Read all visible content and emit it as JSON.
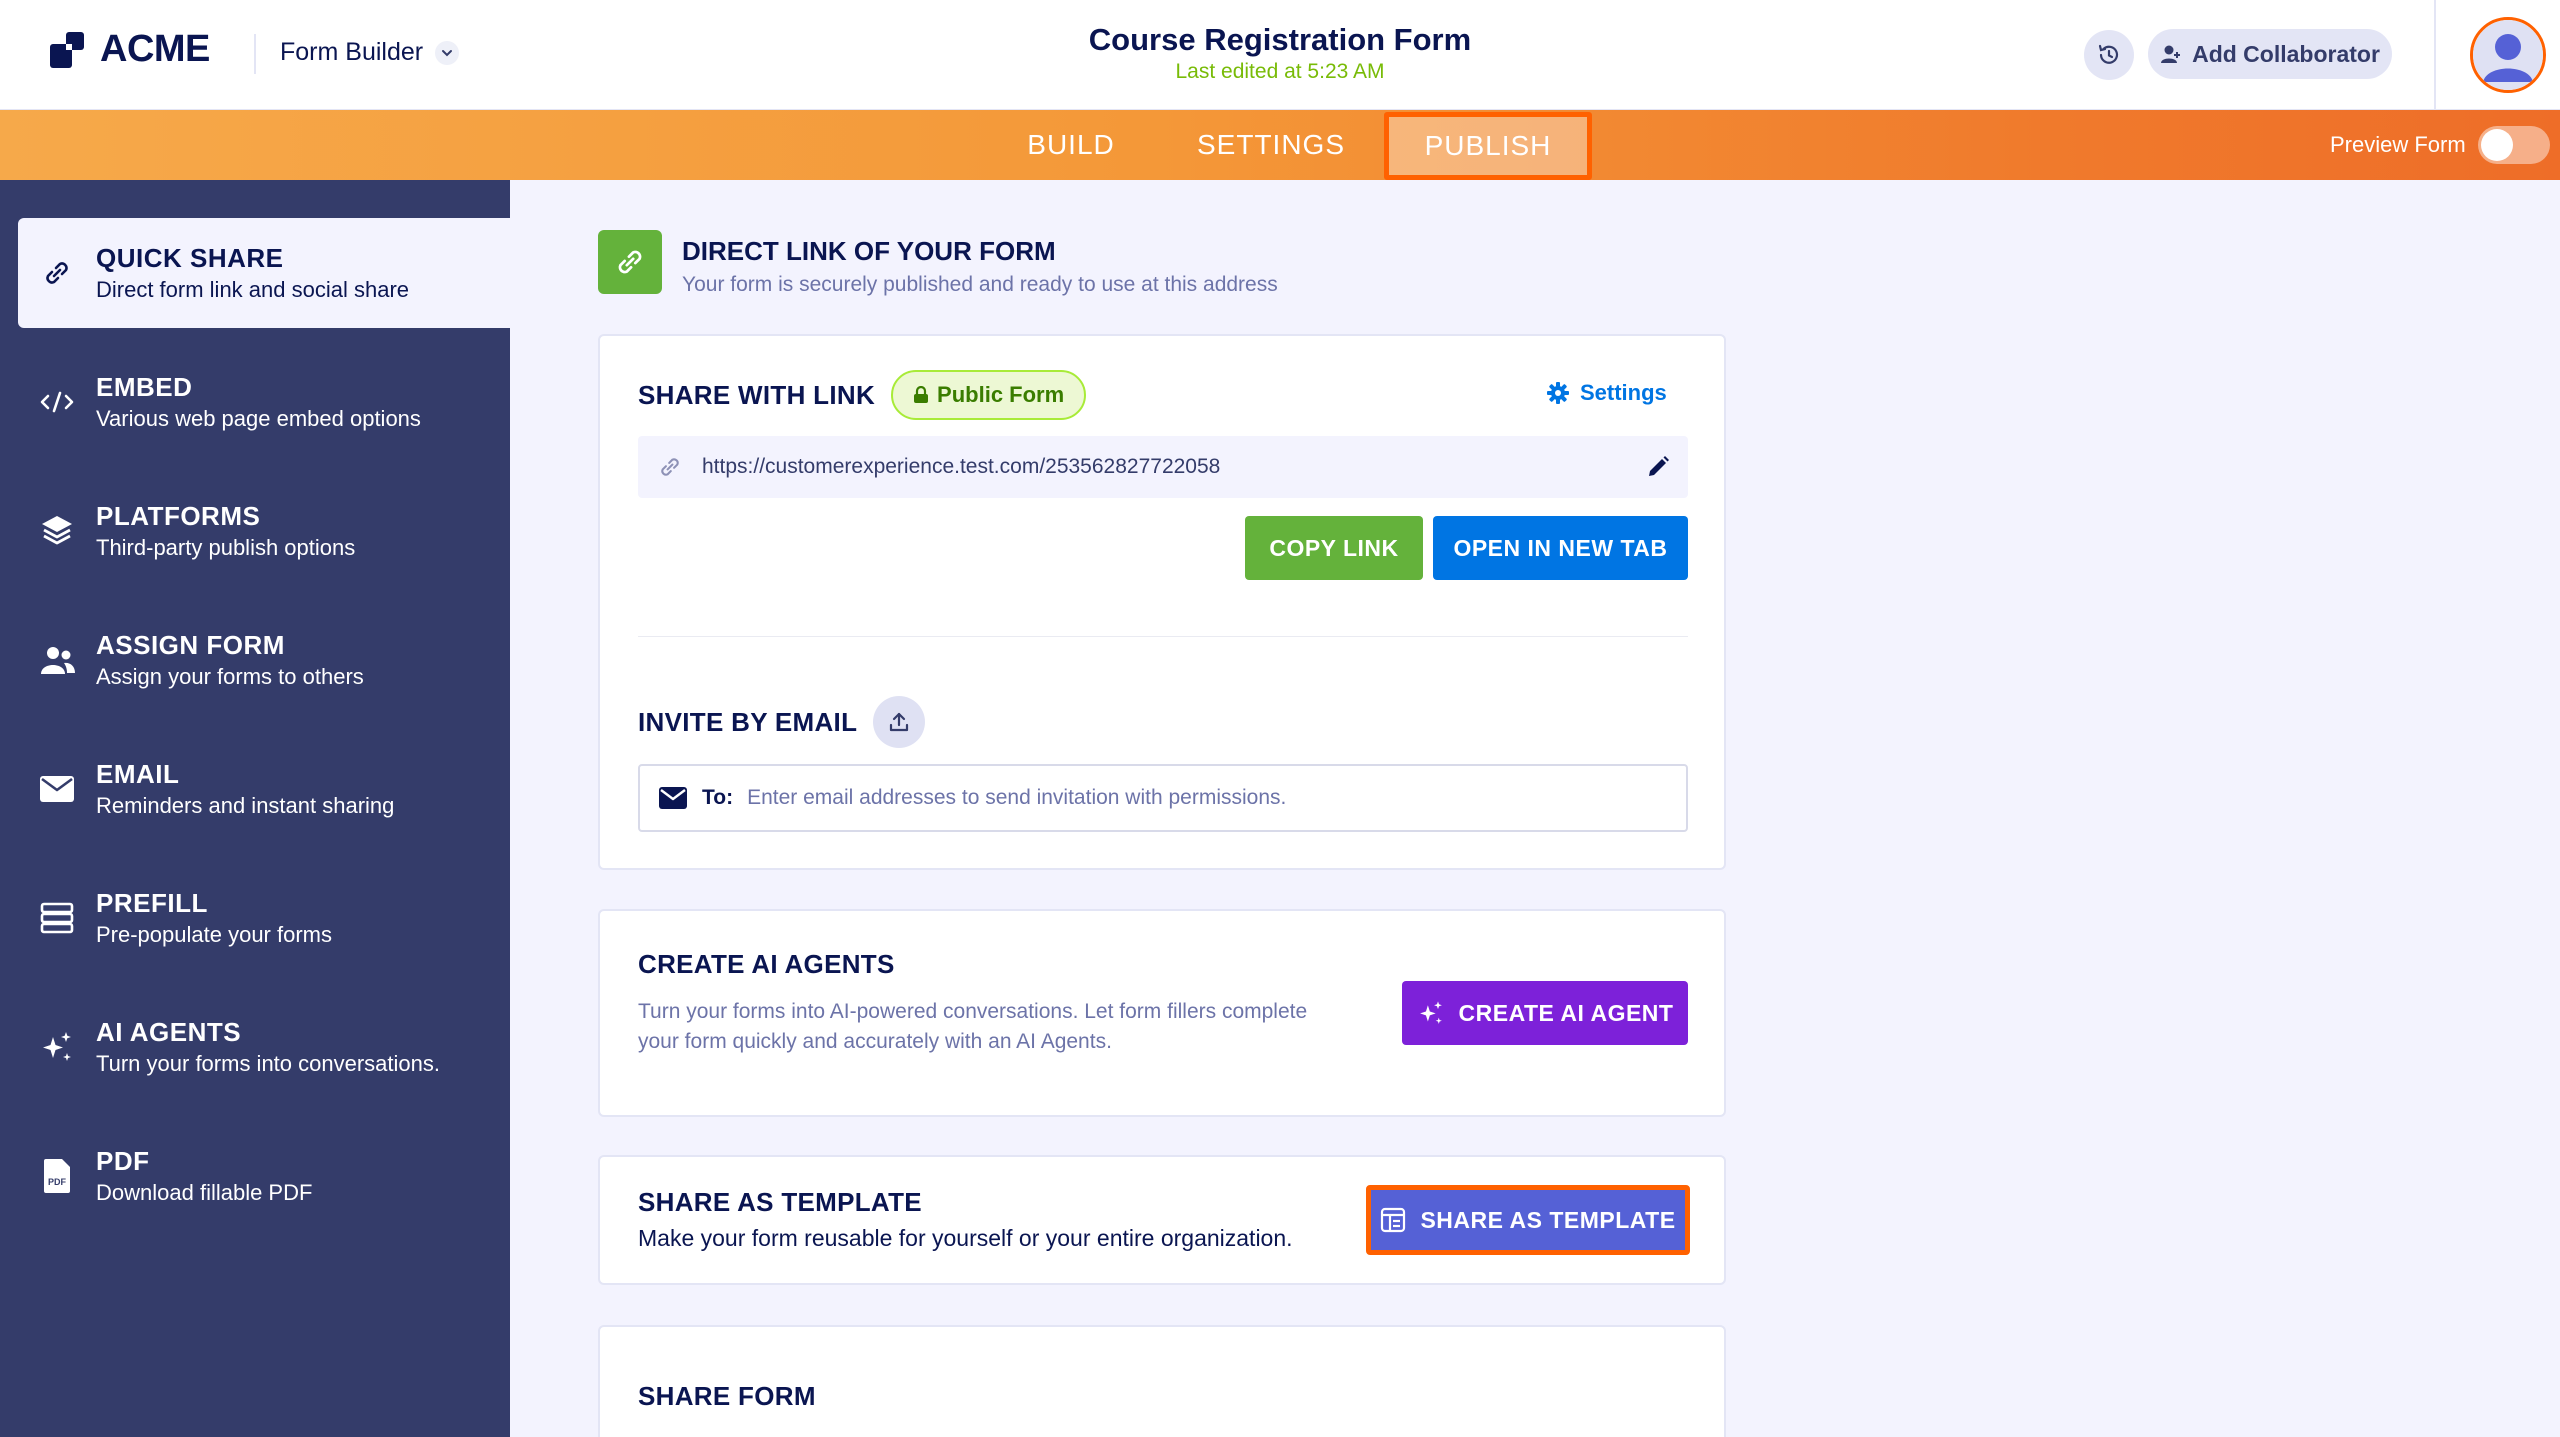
{
  "header": {
    "logo_text": "ACME",
    "product": "Form Builder",
    "form_name": "Course Registration Form",
    "last_edited": "Last edited at 5:23 AM",
    "add_collaborator": "Add Collaborator"
  },
  "tabs": [
    {
      "label": "BUILD",
      "active": false
    },
    {
      "label": "SETTINGS",
      "active": false
    },
    {
      "label": "PUBLISH",
      "active": true
    }
  ],
  "preview": {
    "label": "Preview Form",
    "on": false
  },
  "sidebar": {
    "items": [
      {
        "title": "QUICK SHARE",
        "subtitle": "Direct form link and social share",
        "icon": "link-icon",
        "active": true
      },
      {
        "title": "EMBED",
        "subtitle": "Various web page embed options",
        "icon": "code-icon"
      },
      {
        "title": "PLATFORMS",
        "subtitle": "Third-party publish options",
        "icon": "layers-icon"
      },
      {
        "title": "ASSIGN FORM",
        "subtitle": "Assign your forms to others",
        "icon": "users-icon"
      },
      {
        "title": "EMAIL",
        "subtitle": "Reminders and instant sharing",
        "icon": "envelope-icon"
      },
      {
        "title": "PREFILL",
        "subtitle": "Pre-populate your forms",
        "icon": "database-icon"
      },
      {
        "title": "AI AGENTS",
        "subtitle": "Turn your forms into conversations.",
        "icon": "sparkle-icon"
      },
      {
        "title": "PDF",
        "subtitle": "Download fillable PDF",
        "icon": "pdf-icon"
      }
    ]
  },
  "direct_link": {
    "title": "DIRECT LINK OF YOUR FORM",
    "subtitle": "Your form is securely published and ready to use at this address"
  },
  "share_link": {
    "title": "SHARE WITH LINK",
    "badge": "Public Form",
    "settings": "Settings",
    "url": "https://customerexperience.test.com/253562827722058",
    "copy_label": "COPY LINK",
    "open_label": "OPEN IN NEW TAB"
  },
  "invite": {
    "title": "INVITE BY EMAIL",
    "to_label": "To:",
    "placeholder": "Enter email addresses to send invitation with permissions."
  },
  "ai_agents": {
    "title": "CREATE AI AGENTS",
    "desc_line1": "Turn your forms into AI-powered conversations. Let form fillers complete",
    "desc_line2": "your form quickly and accurately with an AI Agents.",
    "button": "CREATE AI AGENT"
  },
  "template": {
    "title": "SHARE AS TEMPLATE",
    "desc": "Make your form reusable for yourself or your entire organization.",
    "button": "SHARE AS TEMPLATE"
  },
  "share_form": {
    "title": "SHARE FORM"
  },
  "colors": {
    "sidebar": "#343c6a",
    "accent_orange": "#ff6100",
    "green": "#64b23b",
    "blue": "#0075e3",
    "purple": "#7d21d9",
    "indigo": "#5561d6"
  }
}
